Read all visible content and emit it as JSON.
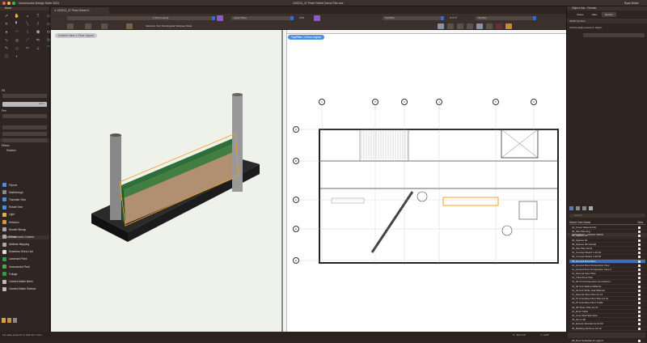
{
  "app": {
    "title": "Vectorworks Design Suite 2023",
    "document_title": "230213_47 Pearl Street Demo File.vwx",
    "user": "Ryan Butler"
  },
  "doc_tab": {
    "label": "230213_47 Pearl Street D..."
  },
  "toolbar": {
    "class_dropdown": "",
    "layer_dropdown": "1-Floor Layout",
    "plane_dropdown": "Layer Plane",
    "zoom": "37%",
    "view_dropdown": "Top/Plan",
    "render_dropdown": "3D Plan",
    "mode_text": "Selection Tool: Rectangular Marquee Mode",
    "scale": "0' 0\" 0\""
  },
  "palettes": {
    "basic": "Basic",
    "attributes": {
      "title": "Attributes",
      "fill": "Fill",
      "pen": "Pen",
      "effects": "Effects",
      "shadow": "Shadow",
      "opacity": "100%"
    },
    "tool_sets": {
      "title": "Tool Sets",
      "items": [
        "Flyover",
        "Walkthrough",
        "Translate View",
        "Rotate View",
        "Light",
        "Heliodon",
        "Render Bitmap",
        "Renderworks Camera",
        "Attribute Mapping",
        "Seamless Direct Line",
        "Landmark Plant",
        "Vectorworks Plant",
        "Foliage",
        "Camera Match Mesh",
        "Camera Match Shadow"
      ]
    }
  },
  "views": {
    "left_label": "Custom View: 1-Floor Layout",
    "right_label": "Top/Plan: 1-Floor Layout"
  },
  "grid": {
    "columns": [
      "1",
      "2",
      "3",
      "4",
      "5",
      "6"
    ],
    "rows": [
      "A",
      "B",
      "C",
      "D",
      "E"
    ]
  },
  "object_info": {
    "title": "Object Info - Render",
    "tabs": [
      "Shape",
      "Data",
      "Render"
    ],
    "active_tab": "Render",
    "object_type": "2D/3D Symbol",
    "message": "Cannot apply texture to object."
  },
  "navigation": {
    "title": "Navigation - Saved Views",
    "search_placeholder": "Search",
    "col_name": "Saved View Name",
    "col_view": "View",
    "selected": "09_Ground Floor Plan",
    "items": [
      "01_Cover Sheet & Info",
      "02_Site Planning",
      "03_Spaces 2d",
      "04_Spaces 3d",
      "05_Spaces 3D Overall",
      "06_Site Plan A0.01",
      "07_Concept Board 1 A0.02",
      "08_Concept Board 2 A0.03",
      "09_Ground Floor Plan",
      "10_Ground Floor Perspective View",
      "11_Ground Floor Perspective View 2",
      "12_Second Floor Plan",
      "13_Third Floor Plan",
      "14_03 Unit Perspective into Kitchen",
      "15_03 Unit Walnut Millwork",
      "16_03 Unit White Oak Millwork",
      "17_Second Floor Plan A1.12",
      "18_07 Amenities Floor Plan A1.13",
      "19_07 Amenities Floor Trellis",
      "20_08 Tower Plan A1.14",
      "21_Roof Trellis",
      "22_Core Stair Edit View",
      "23_All on 3D",
      "24_Exterior Elevations A3.00",
      "25_Building Sections A3.10",
      "26_Renderings RW20.01",
      "27_Window Schedule & Legend A5.01",
      "28_Door Schedule & Legend"
    ]
  },
  "status": {
    "help": "For Help, press F1 or click the ? icon.",
    "x": "X: -46'2 1/2\"",
    "y": "Y: -24'0\""
  },
  "colors": {
    "accent": "#2f6fd6",
    "selection": "#f0a020",
    "panel": "#2e2522",
    "viewport3d": "#eef2ea"
  }
}
